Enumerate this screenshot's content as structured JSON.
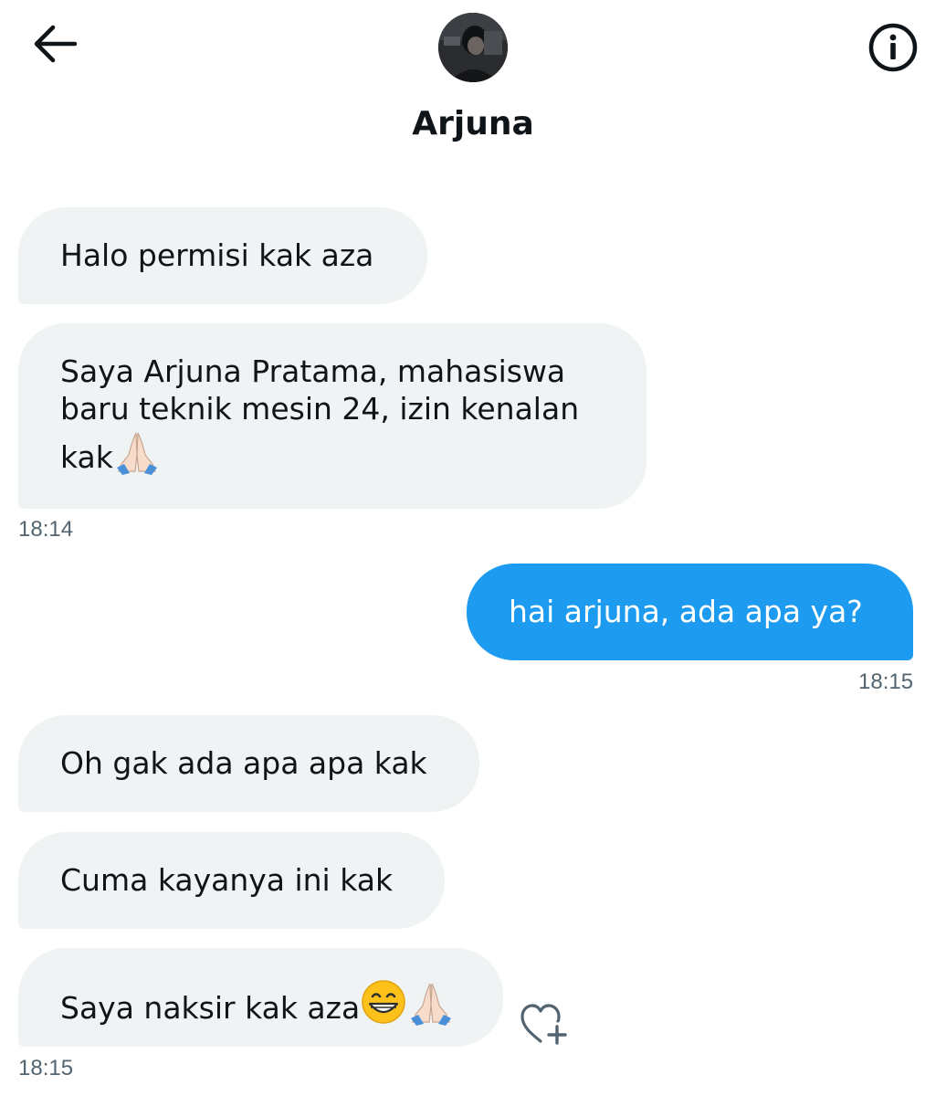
{
  "header": {
    "back_icon": "arrow-left-icon",
    "info_icon": "info-icon",
    "contact_name": "Arjuna"
  },
  "messages": [
    {
      "direction": "incoming",
      "text": "Halo permisi kak aza"
    },
    {
      "direction": "incoming",
      "text": "Saya Arjuna Pratama, mahasiswa baru teknik mesin 24, izin kenalan kak",
      "emoji": [
        "folded-hands-icon"
      ],
      "time": "18:14"
    },
    {
      "direction": "outgoing",
      "text": "hai arjuna, ada apa ya?",
      "time": "18:15"
    },
    {
      "direction": "incoming",
      "text": "Oh gak ada apa apa kak"
    },
    {
      "direction": "incoming",
      "text": "Cuma kayanya ini kak"
    },
    {
      "direction": "incoming",
      "text": "Saya naksir kak aza",
      "emoji": [
        "grinning-face-icon",
        "folded-hands-icon"
      ],
      "time": "18:15"
    }
  ],
  "reaction_icon": "heart-plus-icon",
  "colors": {
    "incoming_bubble": "#eff3f4",
    "outgoing_bubble": "#1d9bf0",
    "timestamp": "#536471",
    "text": "#0f1419"
  }
}
